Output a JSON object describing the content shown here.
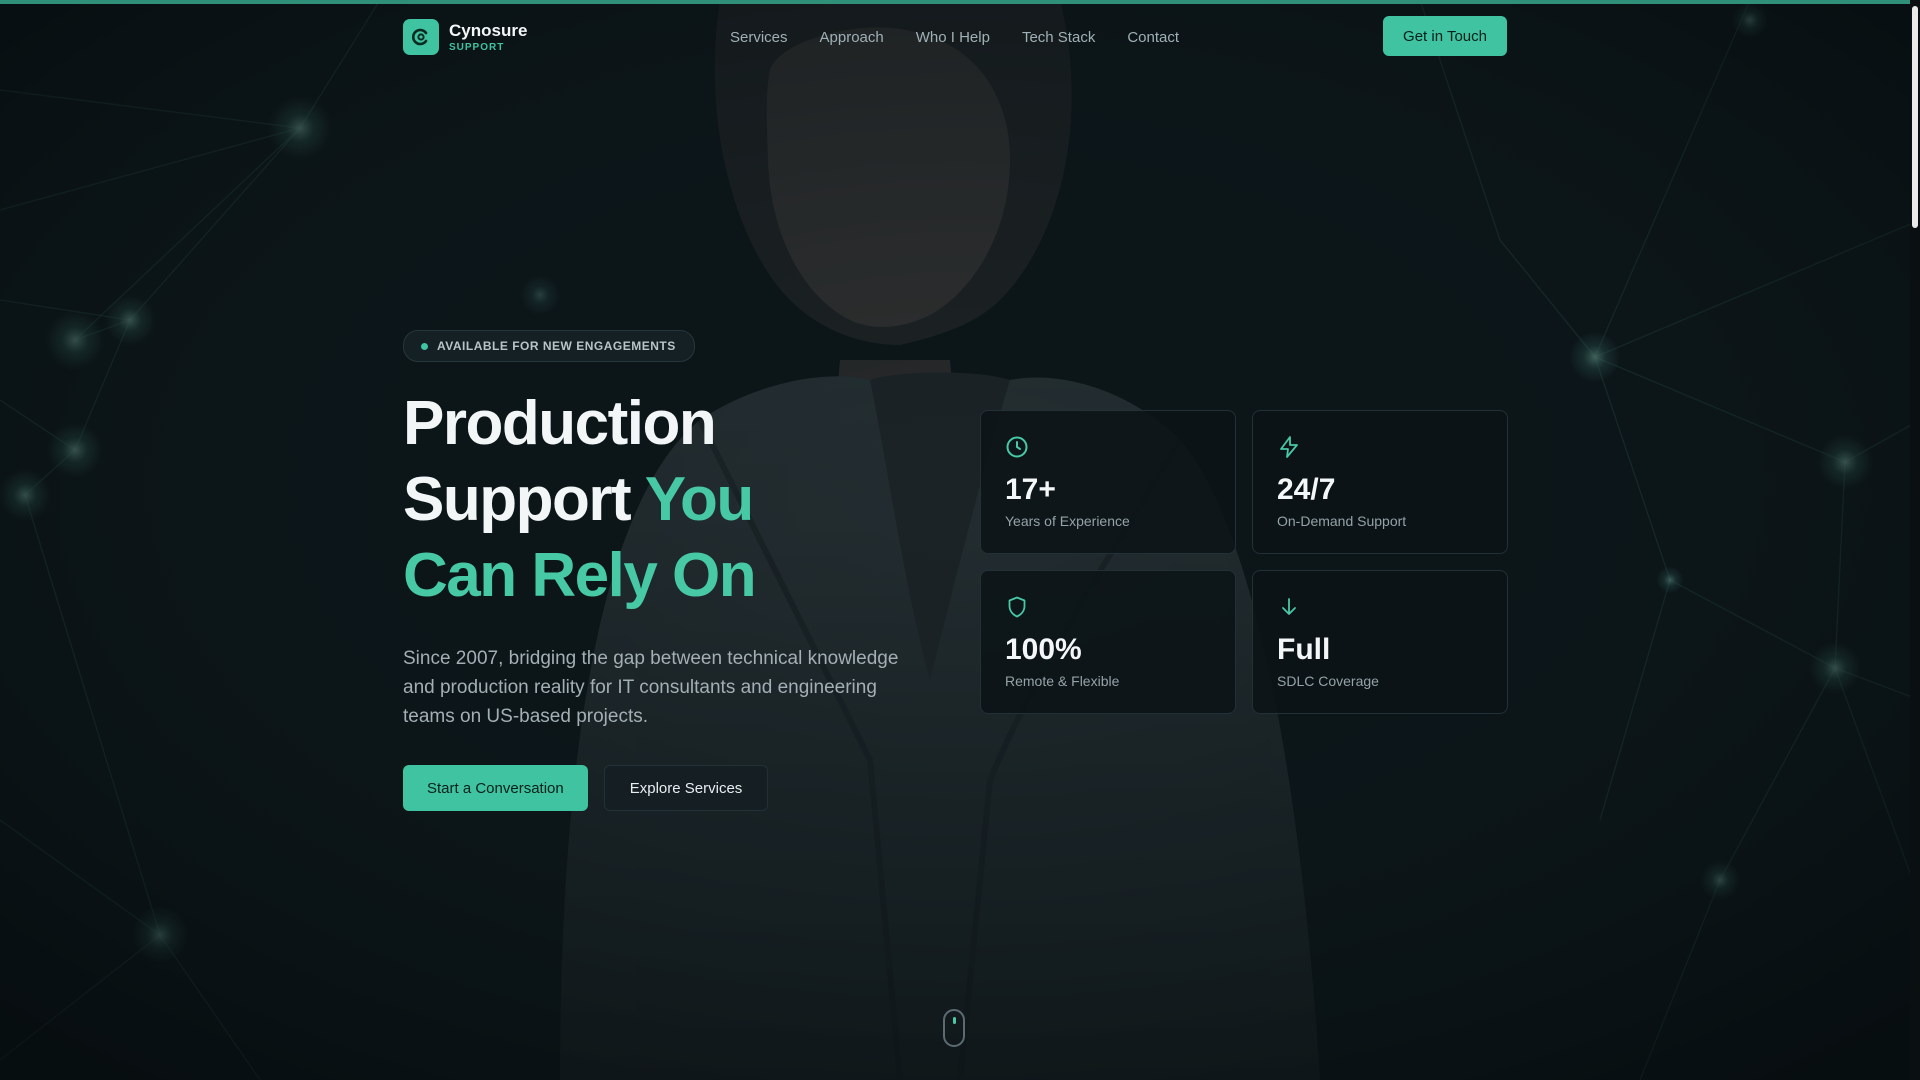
{
  "brand": {
    "name": "Cynosure",
    "tagline": "SUPPORT",
    "logo_icon": "cynosure-logo-icon"
  },
  "nav": {
    "items": [
      {
        "label": "Services"
      },
      {
        "label": "Approach"
      },
      {
        "label": "Who I Help"
      },
      {
        "label": "Tech Stack"
      },
      {
        "label": "Contact"
      }
    ],
    "cta_label": "Get in Touch"
  },
  "hero": {
    "badge": "AVAILABLE FOR NEW ENGAGEMENTS",
    "headline_line1": "Production",
    "headline_line2": "Support",
    "headline_accent1": "You",
    "headline_accent2": "Can Rely On",
    "lead": "Since 2007, bridging the gap between technical knowledge and production reality for IT consultants and engineering teams on US-based projects.",
    "primary_label": "Start a Conversation",
    "secondary_label": "Explore Services"
  },
  "stats": [
    {
      "icon": "clock-icon",
      "value": "17+",
      "label": "Years of Experience"
    },
    {
      "icon": "lightning-icon",
      "value": "24/7",
      "label": "On-Demand Support"
    },
    {
      "icon": "shield-icon",
      "value": "100%",
      "label": "Remote & Flexible"
    },
    {
      "icon": "arrow-down-icon",
      "value": "Full",
      "label": "SDLC Coverage"
    }
  ],
  "colors": {
    "accent": "#3fc3a0",
    "background": "#0d151a",
    "card": "#0b1317"
  }
}
